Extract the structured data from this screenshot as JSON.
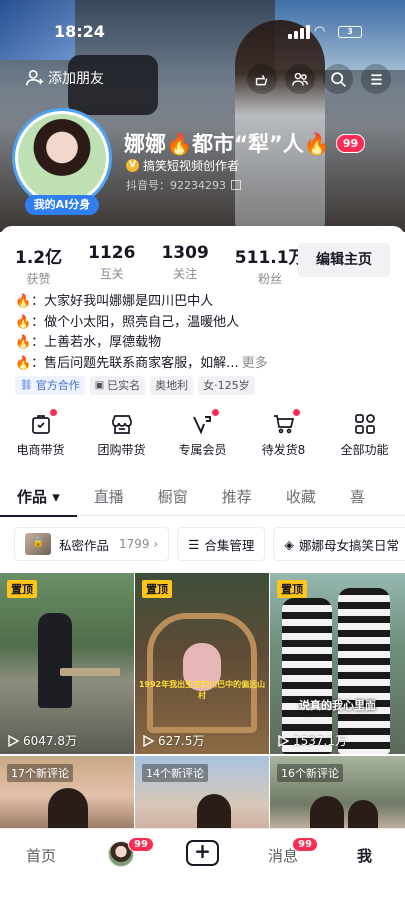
{
  "status_bar": {
    "time": "18:24",
    "battery": "3"
  },
  "header": {
    "add_friend": "添加朋友",
    "nickname": "娜娜🔥都市“犁”人🔥",
    "nick_badge": "99",
    "creator_label": "搞笑短视频创作者",
    "douyin_id": "抖音号：92234293",
    "ai_badge": "我的AI分身"
  },
  "stats": [
    {
      "value": "1.2亿",
      "label": "获赞"
    },
    {
      "value": "1126",
      "label": "互关"
    },
    {
      "value": "1309",
      "label": "关注"
    },
    {
      "value": "511.1万",
      "label": "粉丝"
    }
  ],
  "edit_button": "编辑主页",
  "bio": {
    "lines": [
      "🔥：大家好我叫娜娜是四川巴中人",
      "🔥：做个小太阳，照亮自己，温暖他人",
      "🔥：上善若水，厚德载物",
      "🔥：售后问题先联系商家客服，如解..."
    ],
    "more": "更多"
  },
  "tags": [
    {
      "icon": "⛓",
      "text": "官方合作"
    },
    {
      "icon": "▣",
      "text": "已实名"
    },
    {
      "icon": "",
      "text": "奥地利"
    },
    {
      "icon": "",
      "text": "女·125岁"
    }
  ],
  "shortcuts": [
    {
      "icon": "shopping-bag-icon",
      "label": "电商带货",
      "dot": true
    },
    {
      "icon": "group-buy-icon",
      "label": "团购带货",
      "dot": false
    },
    {
      "icon": "vip-icon",
      "label": "专属会员",
      "dot": true
    },
    {
      "icon": "cart-icon",
      "label": "待发货8",
      "dot": true
    },
    {
      "icon": "grid-icon",
      "label": "全部功能",
      "dot": false
    }
  ],
  "tabs": [
    {
      "label": "作品 ▾",
      "active": true
    },
    {
      "label": "直播",
      "active": false
    },
    {
      "label": "橱窗",
      "active": false
    },
    {
      "label": "推荐",
      "active": false
    },
    {
      "label": "收藏",
      "active": false
    },
    {
      "label": "喜",
      "active": false
    }
  ],
  "subrow": {
    "private_label": "私密作品",
    "private_count": "1799 ›",
    "collection": "合集管理",
    "series": "娜娜母女搞笑日常"
  },
  "videos": [
    {
      "pinned": "置顶",
      "plays": "6047.8万",
      "caption": ""
    },
    {
      "pinned": "置顶",
      "plays": "627.5万",
      "caption": "1992年我出生在四川巴中的偏远山村"
    },
    {
      "pinned": "置顶",
      "plays": "1537.1万",
      "caption": "说真的我心里面"
    },
    {
      "comments": "17个新评论"
    },
    {
      "comments": "14个新评论"
    },
    {
      "comments": "16个新评论"
    }
  ],
  "bottom_nav": {
    "home": "首页",
    "avatar_badge": "99",
    "messages": "消息",
    "messages_badge": "99",
    "me": "我"
  }
}
